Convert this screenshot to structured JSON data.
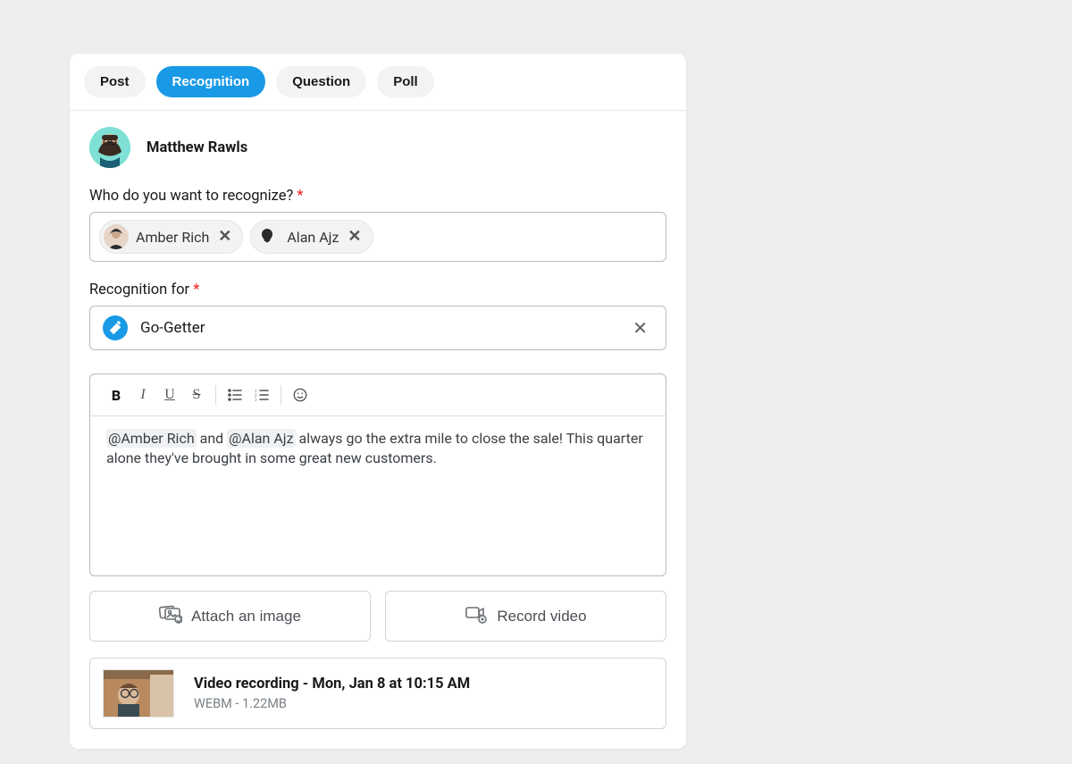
{
  "tabs": {
    "post": "Post",
    "recognition": "Recognition",
    "question": "Question",
    "poll": "Poll",
    "active": "recognition"
  },
  "author": {
    "name": "Matthew Rawls"
  },
  "fields": {
    "who_label": "Who do you want to recognize?",
    "for_label": "Recognition for",
    "required_marker": "*"
  },
  "recognizees": [
    {
      "name": "Amber Rich"
    },
    {
      "name": "Alan Ajz"
    }
  ],
  "recognition_for": {
    "value": "Go-Getter"
  },
  "editor": {
    "mention1": "@Amber Rich",
    "mid1": " and ",
    "mention2": "@Alan Ajz",
    "rest": " always go the extra mile to close the sale! This quarter alone they've brought in some great new customers."
  },
  "attach": {
    "image_label": "Attach an image",
    "video_label": "Record video"
  },
  "media": {
    "title": "Video recording - Mon, Jan 8 at 10:15 AM",
    "meta": "WEBM - 1.22MB"
  }
}
